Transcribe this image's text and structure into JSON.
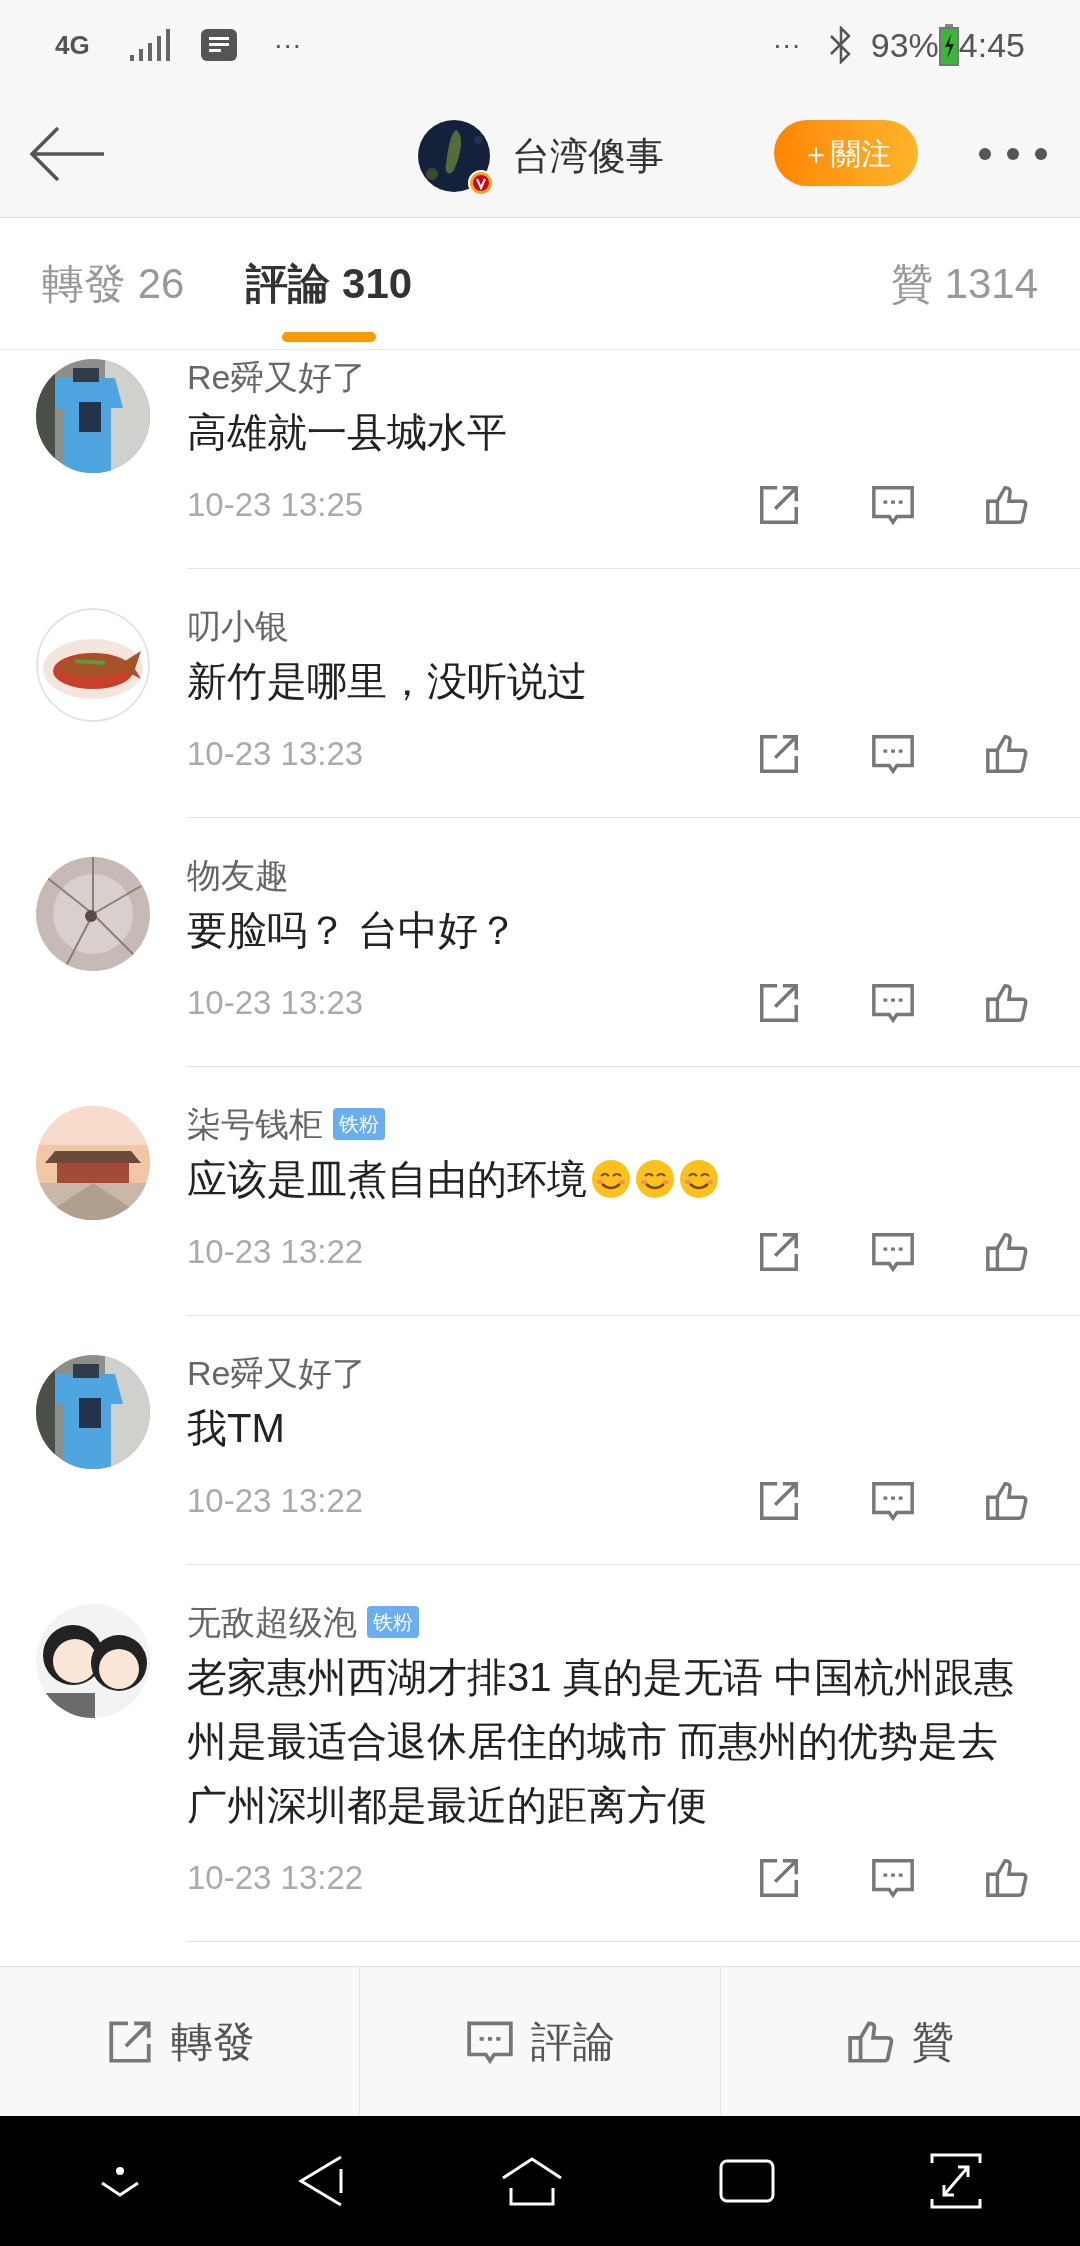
{
  "status_bar": {
    "network": "4G",
    "left_more": "···",
    "right_more": "···",
    "battery": "93%",
    "time": "4:45"
  },
  "header": {
    "title": "台湾傻事",
    "follow_button": "＋關注"
  },
  "tabs": [
    {
      "label": "轉發 26",
      "selected": false
    },
    {
      "label": "評論 310",
      "selected": true
    },
    {
      "label": "贊 1314",
      "selected": false
    }
  ],
  "comments": [
    {
      "user": "Re舜又好了",
      "text": "高雄就一县城水平",
      "time": "10-23 13:25"
    },
    {
      "user": "叨小银",
      "text": "新竹是哪里，没听说过",
      "time": "10-23 13:23"
    },
    {
      "user": "物友趣",
      "text": "要脸吗？ 台中好？",
      "time": "10-23 13:23"
    },
    {
      "user": "柒号钱柜",
      "badge": "铁粉",
      "text": "应该是皿煮自由的环境",
      "emoji": [
        {
          "kind": "smile"
        },
        {
          "kind": "smile"
        },
        {
          "kind": "smile"
        }
      ],
      "time": "10-23 13:22"
    },
    {
      "user": "Re舜又好了",
      "text": "我TM",
      "time": "10-23 13:22"
    },
    {
      "user": "无敌超级泡",
      "badge": "铁粉",
      "text": "老家惠州西湖才排31 真的是无语 中国杭州跟惠州是最适合退休居住的城市 而惠州的优势是去广州深圳都是最近的距离方便",
      "time": "10-23 13:22"
    }
  ],
  "action_bar": [
    {
      "kind": "repost",
      "label": "轉發"
    },
    {
      "kind": "comment",
      "label": "評論"
    },
    {
      "kind": "like",
      "label": "贊"
    }
  ]
}
